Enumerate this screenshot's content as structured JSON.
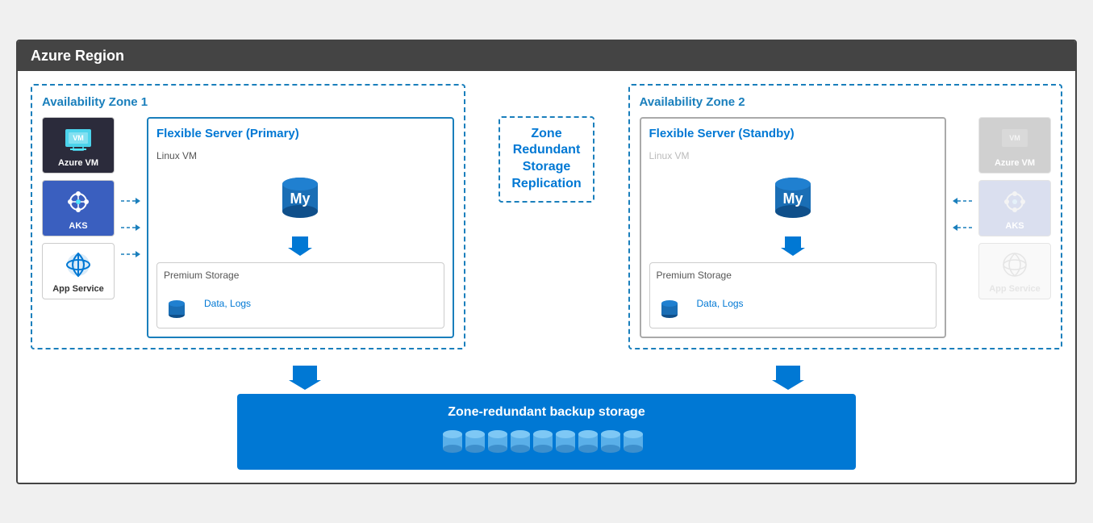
{
  "header": {
    "title": "Azure Region",
    "bg": "#444444"
  },
  "zone1": {
    "label": "Availability Zone 1",
    "flexServer": {
      "title": "Flexible Server (",
      "titleHighlight": "Primary",
      "titleEnd": ")",
      "linuxVM": "Linux VM",
      "storage": {
        "title": "Premium Storage",
        "dataLogs": "Data, Logs"
      }
    },
    "clients": [
      {
        "name": "Azure VM",
        "type": "azure-vm"
      },
      {
        "name": "AKS",
        "type": "aks"
      },
      {
        "name": "App Service",
        "type": "app-service"
      }
    ]
  },
  "zone2": {
    "label": "Availability Zone 2",
    "flexServer": {
      "title": "Flexible Server (",
      "titleHighlight": "Standby",
      "titleEnd": ")",
      "linuxVM": "Linux VM",
      "storage": {
        "title": "Premium Storage",
        "dataLogs": "Data, Logs"
      }
    },
    "clients": [
      {
        "name": "Azure VM",
        "type": "azure-vm"
      },
      {
        "name": "AKS",
        "type": "aks"
      },
      {
        "name": "App Service",
        "type": "app-service"
      }
    ]
  },
  "zrs": {
    "line1": "Zone",
    "line2": "Redundant",
    "line3": "Storage",
    "line4": "Replication"
  },
  "backup": {
    "label": "Zone-redundant backup storage"
  },
  "colors": {
    "blue": "#0078d4",
    "lightBlue": "#1a7fbc",
    "dashed": "#1a7fbc"
  }
}
